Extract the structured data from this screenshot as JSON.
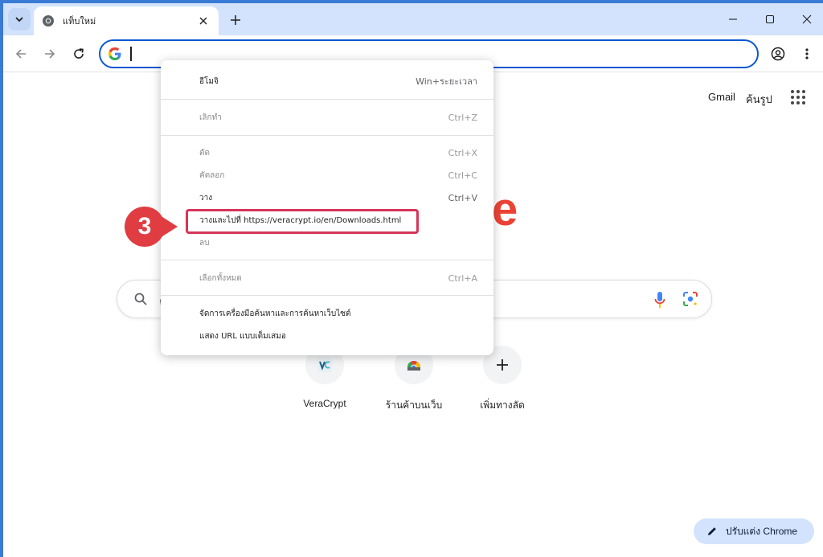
{
  "tab": {
    "title": "แท็บใหม่",
    "favicon": "chrome-icon"
  },
  "window_controls": [
    "minimize-icon",
    "maximize-icon",
    "close-icon"
  ],
  "omnibox": {
    "value": "",
    "placeholder": ""
  },
  "ntp": {
    "gmail": "Gmail",
    "images": "ค้นรูป",
    "logo_fragment": "e",
    "search_text": "ค",
    "shortcuts": [
      {
        "label": "VeraCrypt",
        "icon": "veracrypt-icon"
      },
      {
        "label": "ร้านค้าบนเว็บ",
        "icon": "webstore-icon"
      },
      {
        "label": "เพิ่มทางลัด",
        "icon": "plus-icon"
      }
    ],
    "customize": "ปรับแต่ง Chrome"
  },
  "menu": {
    "emoji": {
      "label": "อีโมจิ",
      "shortcut": "Win+ระยะเวลา"
    },
    "undo": {
      "label": "เลิกทำ",
      "shortcut": "Ctrl+Z"
    },
    "cut": {
      "label": "ตัด",
      "shortcut": "Ctrl+X"
    },
    "copy": {
      "label": "คัดลอก",
      "shortcut": "Ctrl+C"
    },
    "paste": {
      "label": "วาง",
      "shortcut": "Ctrl+V"
    },
    "paste_go": {
      "label": "วางและไปที่ https://veracrypt.io/en/Downloads.html"
    },
    "delete": {
      "label": "ลบ"
    },
    "select_all": {
      "label": "เลือกทั้งหมด",
      "shortcut": "Ctrl+A"
    },
    "manage_search": {
      "label": "จัดการเครื่องมือค้นหาและการค้นหาเว็บไซต์"
    },
    "show_full_url": {
      "label": "แสดง URL แบบเต็มเสมอ"
    }
  },
  "annotation": {
    "step": "3",
    "color": "#e03d43"
  },
  "colors": {
    "accent": "#0b57d0",
    "tabstrip": "#d3e3fd",
    "highlight": "#d6355a"
  }
}
